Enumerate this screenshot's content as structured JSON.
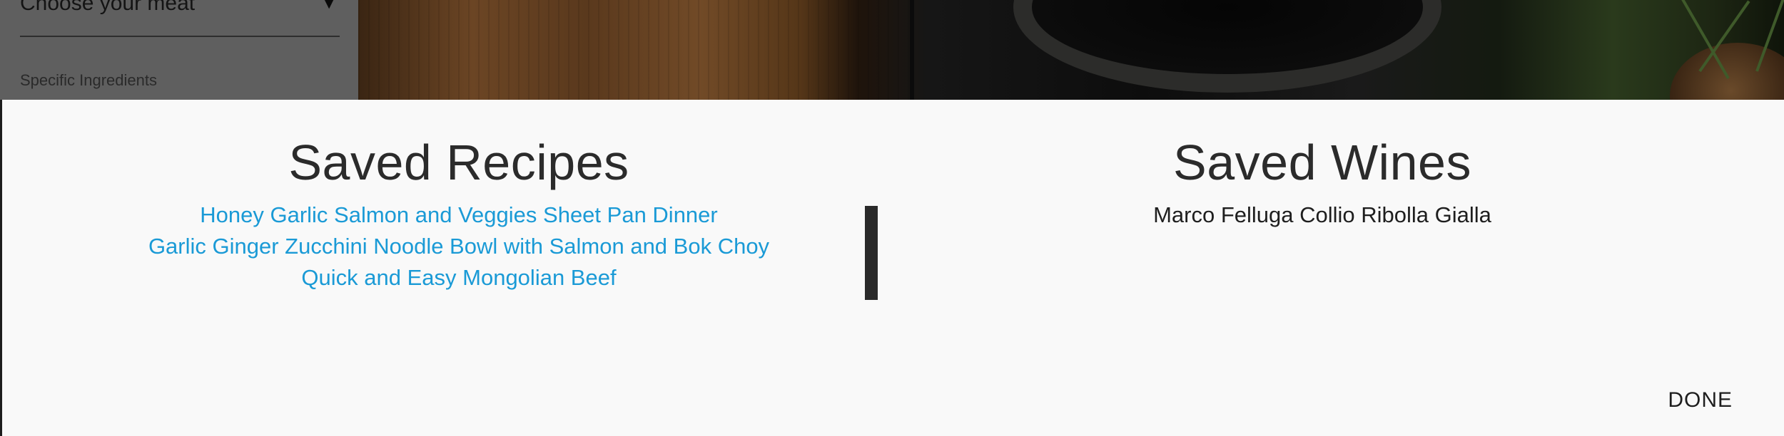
{
  "background": {
    "sidebar": {
      "meat_select_value": "Choose your meat",
      "ingredients_label": "Specific Ingredients"
    }
  },
  "modal": {
    "recipes": {
      "title": "Saved Recipes",
      "items": [
        "Honey Garlic Salmon and Veggies Sheet Pan Dinner",
        "Garlic Ginger Zucchini Noodle Bowl with Salmon and Bok Choy",
        "Quick and Easy Mongolian Beef"
      ]
    },
    "wines": {
      "title": "Saved Wines",
      "items": [
        "Marco Felluga Collio Ribolla Gialla"
      ]
    },
    "done_label": "DONE"
  },
  "colors": {
    "link": "#1a9ad6",
    "modal_background": "#f9f9f9",
    "text": "#2b2b2b"
  }
}
